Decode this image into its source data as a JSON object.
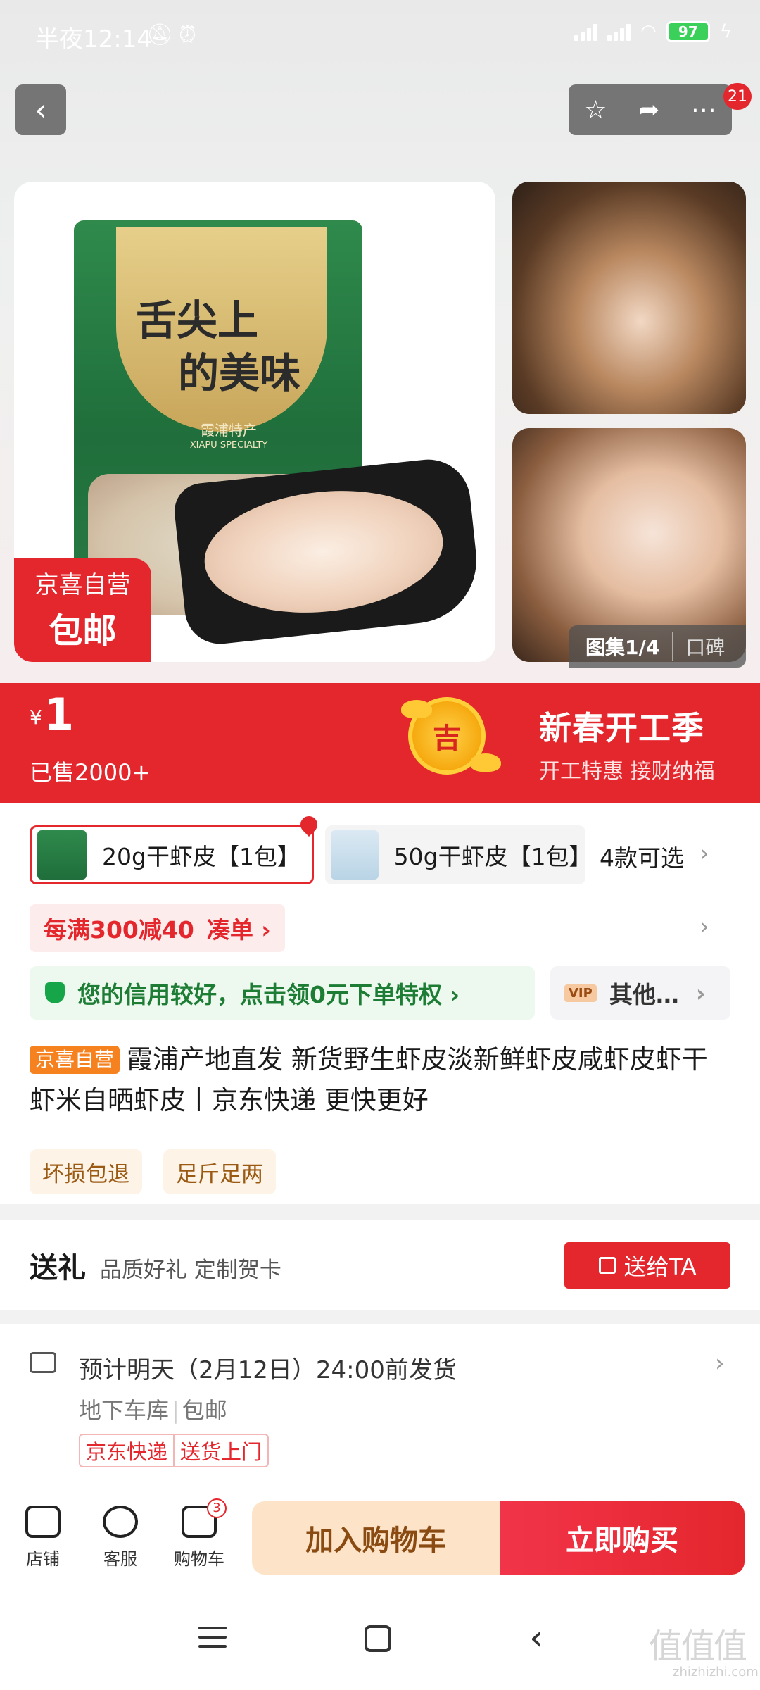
{
  "status_bar": {
    "time": "半夜12:14",
    "battery": "97"
  },
  "header": {
    "cart_badge": "21"
  },
  "gallery": {
    "main_tag_line1": "京喜自营",
    "main_tag_line2": "包邮",
    "package_title_1": "舌尖上",
    "package_title_2": "的美味",
    "package_subtitle": "霞浦特产",
    "package_subtitle_en": "XIAPU SPECIALTY",
    "counter": "图集1/4",
    "reviews_label": "口碑"
  },
  "price": {
    "currency": "¥",
    "value": "1",
    "sold": "已售2000+",
    "lucky_char": "吉",
    "promo_title": "新春开工季",
    "promo_sub": "开工特惠 接财纳福"
  },
  "sku": {
    "options": [
      {
        "label": "20g干虾皮【1包】",
        "selected": true
      },
      {
        "label": "50g干虾皮【1包】",
        "selected": false
      }
    ],
    "more": "4款可选"
  },
  "coupon": {
    "label": "每满300减40",
    "action": "凑单 ›"
  },
  "credit": {
    "label": "您的信用较好，点击领0元下单特权 ›"
  },
  "vip": {
    "tag": "VIP",
    "label": "其他…"
  },
  "product": {
    "self_tag": "京喜自营",
    "title": "霞浦产地直发 新货野生虾皮淡新鲜虾皮咸虾皮虾干虾米自晒虾皮丨京东快递 更快更好",
    "services": [
      "坏损包退",
      "足斤足两"
    ]
  },
  "gift": {
    "title": "送礼",
    "subtitle": "品质好礼 定制贺卡",
    "button": "送给TA"
  },
  "delivery": {
    "eta": "预计明天（2月12日）24:00前发货",
    "from": "地下车库",
    "shipping": "包邮",
    "carrier": "京东快递",
    "door": "送货上门"
  },
  "actions": {
    "shop": "店铺",
    "service": "客服",
    "cart": "购物车",
    "cart_count": "3",
    "add_to_cart": "加入购物车",
    "buy_now": "立即购买"
  },
  "watermark": {
    "text": "值值值",
    "url": "zhizhizhi.com"
  }
}
